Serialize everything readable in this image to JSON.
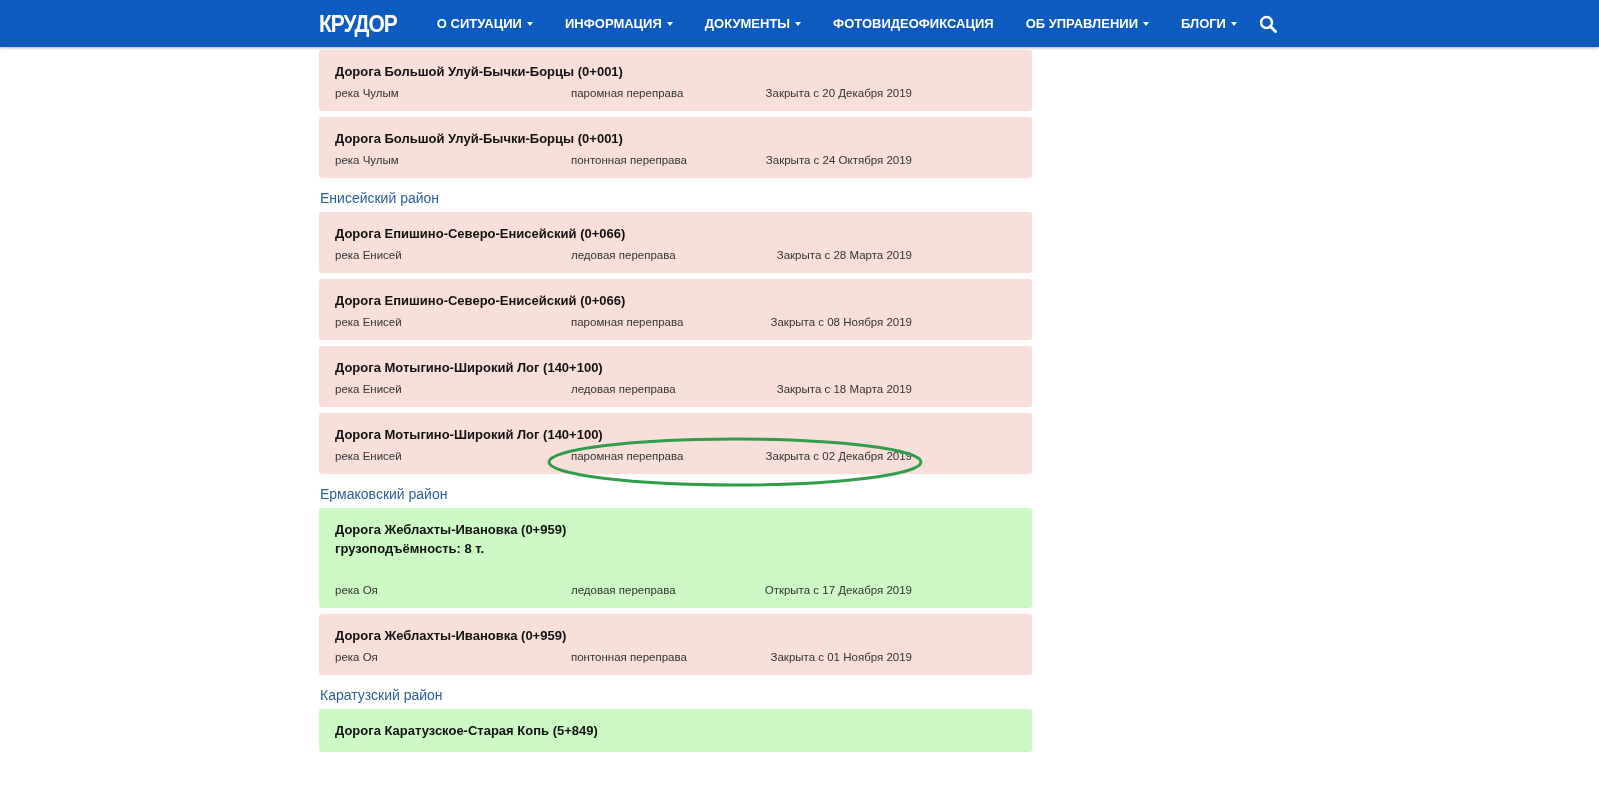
{
  "header": {
    "logo": "КРУДОР",
    "nav": [
      {
        "label": "О СИТУАЦИИ",
        "dropdown": true
      },
      {
        "label": "ИНФОРМАЦИЯ",
        "dropdown": true
      },
      {
        "label": "ДОКУМЕНТЫ",
        "dropdown": true
      },
      {
        "label": "ФОТОВИДЕОФИКСАЦИЯ",
        "dropdown": false
      },
      {
        "label": "ОБ УПРАВЛЕНИИ",
        "dropdown": true
      },
      {
        "label": "БЛОГИ",
        "dropdown": true
      }
    ]
  },
  "sections": [
    {
      "crossings": [
        {
          "title": "Дорога Большой Улуй-Бычки-Борцы (0+001)",
          "river": "река Чулым",
          "type": "паромная переправа",
          "status": "Закрыта с 20 Декабря 2019",
          "open": false,
          "circled": false
        },
        {
          "title": "Дорога Большой Улуй-Бычки-Борцы (0+001)",
          "river": "река Чулым",
          "type": "понтонная переправа",
          "status": "Закрыта с 24 Октября 2019",
          "open": false,
          "circled": false
        }
      ]
    },
    {
      "district": "Енисейский район",
      "crossings": [
        {
          "title": "Дорога Епишино-Северо-Енисейский (0+066)",
          "river": "река Енисей",
          "type": "ледовая переправа",
          "status": "Закрыта с 28 Марта 2019",
          "open": false,
          "circled": false
        },
        {
          "title": "Дорога Епишино-Северо-Енисейский (0+066)",
          "river": "река Енисей",
          "type": "паромная переправа",
          "status": "Закрыта с 08 Ноября 2019",
          "open": false,
          "circled": false
        },
        {
          "title": "Дорога Мотыгино-Широкий Лог (140+100)",
          "river": "река Енисей",
          "type": "ледовая переправа",
          "status": "Закрыта с 18 Марта 2019",
          "open": false,
          "circled": false
        },
        {
          "title": "Дорога Мотыгино-Широкий Лог (140+100)",
          "river": "река Енисей",
          "type": "паромная переправа",
          "status": "Закрыта с 02 Декабря 2019",
          "open": false,
          "circled": true
        }
      ]
    },
    {
      "district": "Ермаковский район",
      "crossings": [
        {
          "title": "Дорога Жеблахты-Ивановка (0+959)",
          "capacity": "грузоподъёмность: 8 т.",
          "river": "река Оя",
          "type": "ледовая переправа",
          "status": "Открыта с 17 Декабря 2019",
          "open": true,
          "circled": false
        },
        {
          "title": "Дорога Жеблахты-Ивановка (0+959)",
          "river": "река Оя",
          "type": "понтонная переправа",
          "status": "Закрыта с 01 Ноября 2019",
          "open": false,
          "circled": false
        }
      ]
    },
    {
      "district": "Каратузский район",
      "crossings": [
        {
          "title": "Дорога Каратузское-Старая Копь (5+849)",
          "open": true,
          "circled": false
        }
      ]
    }
  ]
}
